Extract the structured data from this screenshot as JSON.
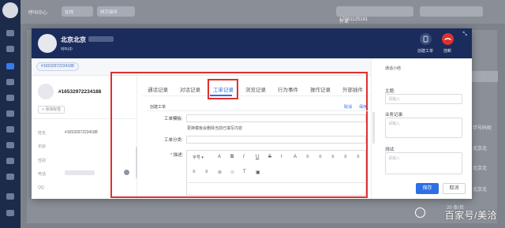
{
  "background": {
    "app_title": "呼叫中心",
    "status": "在线",
    "mode": "网页接听",
    "phone_label": "外显号码：",
    "phone_value": "17081125161",
    "right_col": [
      "学号码呢",
      "北京北",
      "北京北",
      "北京北"
    ],
    "pagination": "20 条/页"
  },
  "call": {
    "name": "北京北京",
    "status": "呼叫中",
    "create_ticket_label": "创建工单",
    "hangup_label": "挂断"
  },
  "tag": "#16532972234188",
  "customer": {
    "title": "#16532972234188",
    "add_tag": "+ 添加标签",
    "fields": [
      {
        "label": "姓名",
        "value": "#16532972234188"
      },
      {
        "label": "年龄",
        "value": ""
      },
      {
        "label": "性别",
        "value": ""
      },
      {
        "label": "电话",
        "value": ""
      },
      {
        "label": "QQ",
        "value": ""
      }
    ]
  },
  "tabs": [
    "通话记录",
    "对话记录",
    "工单记录",
    "浏览记录",
    "行为事件",
    "操作记录",
    "外部插件"
  ],
  "active_tab": 2,
  "ticket_form": {
    "header": "创建工单",
    "cancel": "取消",
    "save": "保存",
    "template_label": "工单模板:",
    "template_hint": "更换模板会删除当前已填写内容",
    "category_label": "工单分类:",
    "desc_label": "描述:",
    "required_mark": "*",
    "toolbar_row1": [
      "字号",
      "A",
      "B",
      "I",
      "U",
      "S",
      "I",
      "A",
      "≡",
      "≡",
      "≡",
      "≡",
      "≡",
      "≡"
    ],
    "toolbar_row2": [
      "≡",
      "≡",
      "⊘",
      "⊘",
      "T",
      "▣"
    ]
  },
  "summary": {
    "title": "通话小结",
    "topic_label": "主题:",
    "topic_placeholder": "请输入",
    "record_label": "业务记录:",
    "record_placeholder": "请输入",
    "test_label": "测试:",
    "test_placeholder": "请输入",
    "save_button": "保存",
    "cancel_button": "取消"
  },
  "watermark": "百家号/美洽",
  "colors": {
    "header_bg": "#1a2c5b",
    "accent": "#2f6fe4",
    "hangup": "#e0302e",
    "highlight_box": "#e0302e"
  }
}
